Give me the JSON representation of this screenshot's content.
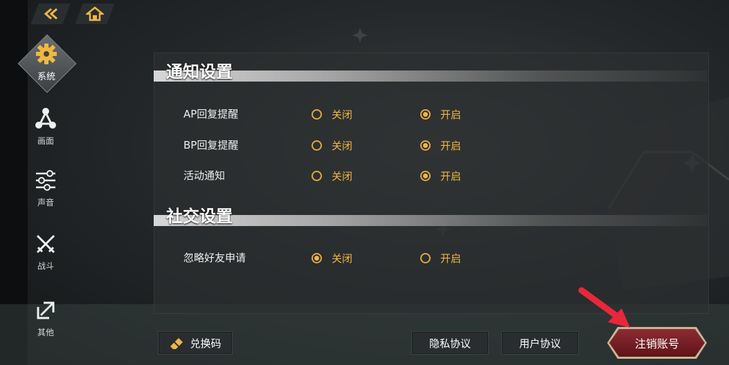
{
  "sidebar": {
    "items": [
      {
        "label": "系统",
        "icon": "gear-icon",
        "active": true
      },
      {
        "label": "画面",
        "icon": "triangle-nodes-icon",
        "active": false
      },
      {
        "label": "声音",
        "icon": "sliders-icon",
        "active": false
      },
      {
        "label": "战斗",
        "icon": "crossed-swords-icon",
        "active": false
      },
      {
        "label": "其他",
        "icon": "arrow-box-icon",
        "active": false
      }
    ]
  },
  "topnav": {
    "back_icon": "back-arrow-icon",
    "home_icon": "home-icon"
  },
  "sections": [
    {
      "title": "通知设置",
      "rows": [
        {
          "label": "AP回复提醒",
          "off_label": "关闭",
          "on_label": "开启",
          "selected": "on"
        },
        {
          "label": "BP回复提醒",
          "off_label": "关闭",
          "on_label": "开启",
          "selected": "on"
        },
        {
          "label": "活动通知",
          "off_label": "关闭",
          "on_label": "开启",
          "selected": "on"
        }
      ]
    },
    {
      "title": "社交设置",
      "rows": [
        {
          "label": "忽略好友申请",
          "off_label": "关闭",
          "on_label": "开启",
          "selected": "off"
        }
      ]
    }
  ],
  "buttons": {
    "redeem": "兑换码",
    "privacy": "隐私协议",
    "user_agreement": "用户协议",
    "delete_account": "注销账号"
  },
  "colors": {
    "accent": "#f0b840",
    "danger": "#8c2b33",
    "annotation_arrow": "#e8283a"
  }
}
